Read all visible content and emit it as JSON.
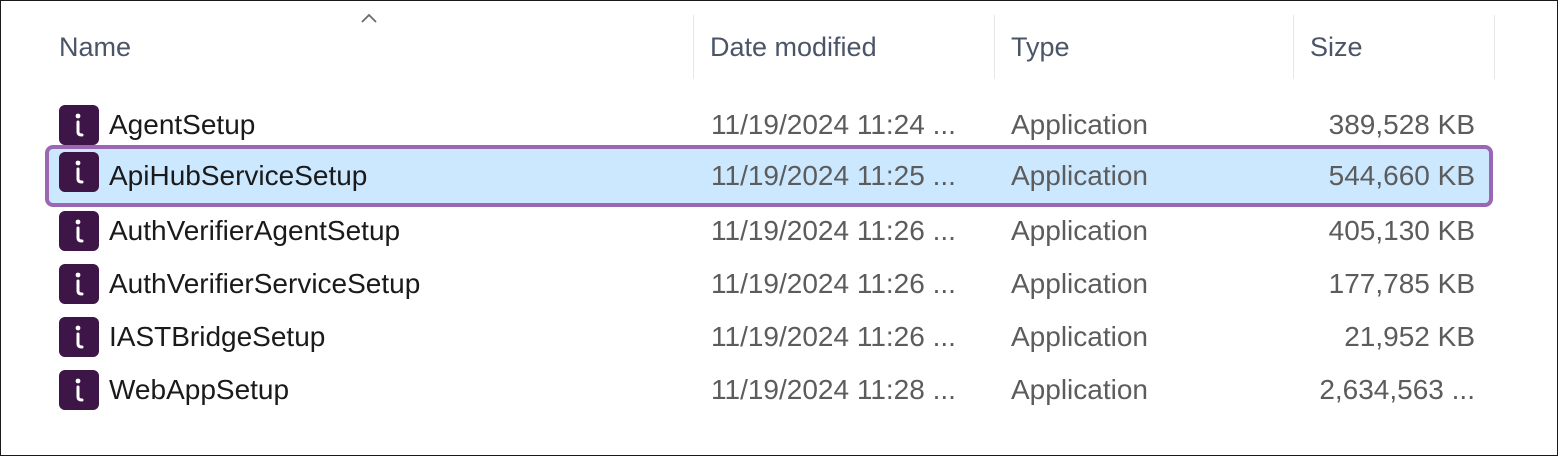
{
  "columns": {
    "name": "Name",
    "date_modified": "Date modified",
    "type": "Type",
    "size": "Size"
  },
  "sort": {
    "column": "name",
    "direction": "ascending"
  },
  "files": [
    {
      "name": "AgentSetup",
      "date": "11/19/2024 11:24 ...",
      "type": "Application",
      "size": "389,528 KB",
      "icon": "installer-app-icon",
      "selected": false
    },
    {
      "name": "ApiHubServiceSetup",
      "date": "11/19/2024 11:25 ...",
      "type": "Application",
      "size": "544,660 KB",
      "icon": "installer-app-icon",
      "selected": true
    },
    {
      "name": "AuthVerifierAgentSetup",
      "date": "11/19/2024 11:26 ...",
      "type": "Application",
      "size": "405,130 KB",
      "icon": "installer-app-icon",
      "selected": false
    },
    {
      "name": "AuthVerifierServiceSetup",
      "date": "11/19/2024 11:26 ...",
      "type": "Application",
      "size": "177,785 KB",
      "icon": "installer-app-icon",
      "selected": false
    },
    {
      "name": "IASTBridgeSetup",
      "date": "11/19/2024 11:26 ...",
      "type": "Application",
      "size": "21,952 KB",
      "icon": "installer-app-icon",
      "selected": false
    },
    {
      "name": "WebAppSetup",
      "date": "11/19/2024 11:28 ...",
      "type": "Application",
      "size": "2,634,563 ...",
      "icon": "installer-app-icon",
      "selected": false
    }
  ],
  "colors": {
    "selection_background": "#cce8ff",
    "highlight_border": "#9b66b4",
    "icon_background": "#3d1547"
  }
}
